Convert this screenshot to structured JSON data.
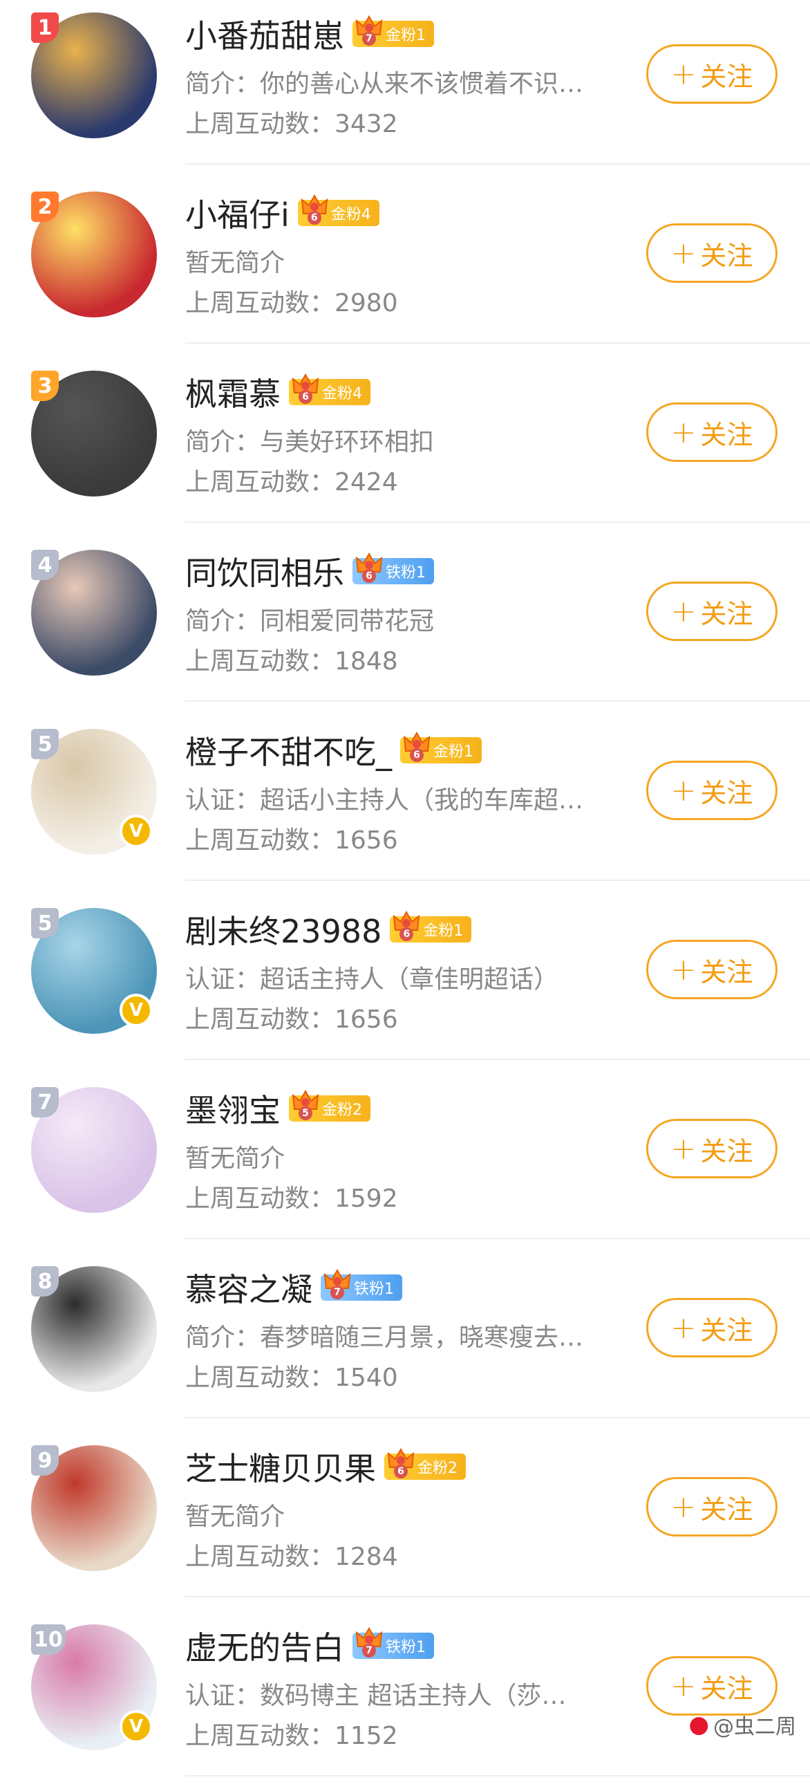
{
  "users": [
    {
      "rank": "1",
      "rank_color": "#f24a4a",
      "name": "小番茄甜崽",
      "badge_level": "7",
      "badge_label": "金粉1",
      "badge_type": "gold",
      "intro": "简介：你的善心从来不该惯着不识…",
      "count": "上周互动数：3432",
      "follow_label": "关注",
      "avatar_color": "#2b3a6d",
      "avatar_color2": "#e9b24c",
      "verified": false
    },
    {
      "rank": "2",
      "rank_color": "#ff7a2e",
      "name": "小福仔i",
      "badge_level": "6",
      "badge_label": "金粉4",
      "badge_type": "gold",
      "intro": "暂无简介",
      "count": "上周互动数：2980",
      "follow_label": "关注",
      "avatar_color": "#c8282f",
      "avatar_color2": "#ffe066",
      "verified": false
    },
    {
      "rank": "3",
      "rank_color": "#ffa52a",
      "name": "枫霜慕",
      "badge_level": "6",
      "badge_label": "金粉4",
      "badge_type": "gold",
      "intro": "简介：与美好环环相扣",
      "count": "上周互动数：2424",
      "follow_label": "关注",
      "avatar_color": "#3a3a3a",
      "avatar_color2": "#555555",
      "verified": false
    },
    {
      "rank": "4",
      "rank_color": "#b6bccc",
      "name": "同饮同相乐",
      "badge_level": "6",
      "badge_label": "铁粉1",
      "badge_type": "iron",
      "intro": "简介：同相爱同带花冠",
      "count": "上周互动数：1848",
      "follow_label": "关注",
      "avatar_color": "#3b4a66",
      "avatar_color2": "#e8c9b8",
      "verified": false
    },
    {
      "rank": "5",
      "rank_color": "#b6bccc",
      "name": "橙子不甜不吃_",
      "badge_level": "6",
      "badge_label": "金粉1",
      "badge_type": "gold",
      "intro": "认证：超话小主持人（我的车库超…",
      "count": "上周互动数：1656",
      "follow_label": "关注",
      "avatar_color": "#f4efe6",
      "avatar_color2": "#d9c7a8",
      "verified": true
    },
    {
      "rank": "5",
      "rank_color": "#b6bccc",
      "name": "剧未终23988",
      "badge_level": "6",
      "badge_label": "金粉1",
      "badge_type": "gold",
      "intro": "认证：超话主持人（章佳明超话）",
      "count": "上周互动数：1656",
      "follow_label": "关注",
      "avatar_color": "#4d95b8",
      "avatar_color2": "#a8d5e8",
      "verified": true
    },
    {
      "rank": "7",
      "rank_color": "#b6bccc",
      "name": "墨翎宝",
      "badge_level": "5",
      "badge_label": "金粉2",
      "badge_type": "gold",
      "intro": "暂无简介",
      "count": "上周互动数：1592",
      "follow_label": "关注",
      "avatar_color": "#d9c3e8",
      "avatar_color2": "#f5e9f7",
      "verified": false
    },
    {
      "rank": "8",
      "rank_color": "#b6bccc",
      "name": "慕容之凝",
      "badge_level": "7",
      "badge_label": "铁粉1",
      "badge_type": "iron",
      "intro": "简介：春梦暗随三月景，晓寒瘦去…",
      "count": "上周互动数：1540",
      "follow_label": "关注",
      "avatar_color": "#e8e8ea",
      "avatar_color2": "#2c2c2c",
      "verified": false
    },
    {
      "rank": "9",
      "rank_color": "#b6bccc",
      "name": "芝士糖贝贝果",
      "badge_level": "6",
      "badge_label": "金粉2",
      "badge_type": "gold",
      "intro": "暂无简介",
      "count": "上周互动数：1284",
      "follow_label": "关注",
      "avatar_color": "#e8d9c8",
      "avatar_color2": "#c0392b",
      "verified": false
    },
    {
      "rank": "10",
      "rank_color": "#b6bccc",
      "name": "虚无的告白",
      "badge_level": "7",
      "badge_label": "铁粉1",
      "badge_type": "iron",
      "intro": "认证：数码博主 超话主持人（莎…",
      "count": "上周互动数：1152",
      "follow_label": "关注",
      "avatar_color": "#e8f0f5",
      "avatar_color2": "#d97aa8",
      "verified": true
    }
  ],
  "watermark": {
    "text": "@虫二周",
    "icon": "weibo-icon"
  },
  "colors": {
    "accent": "#f39c12",
    "divider": "#eeeeee"
  }
}
